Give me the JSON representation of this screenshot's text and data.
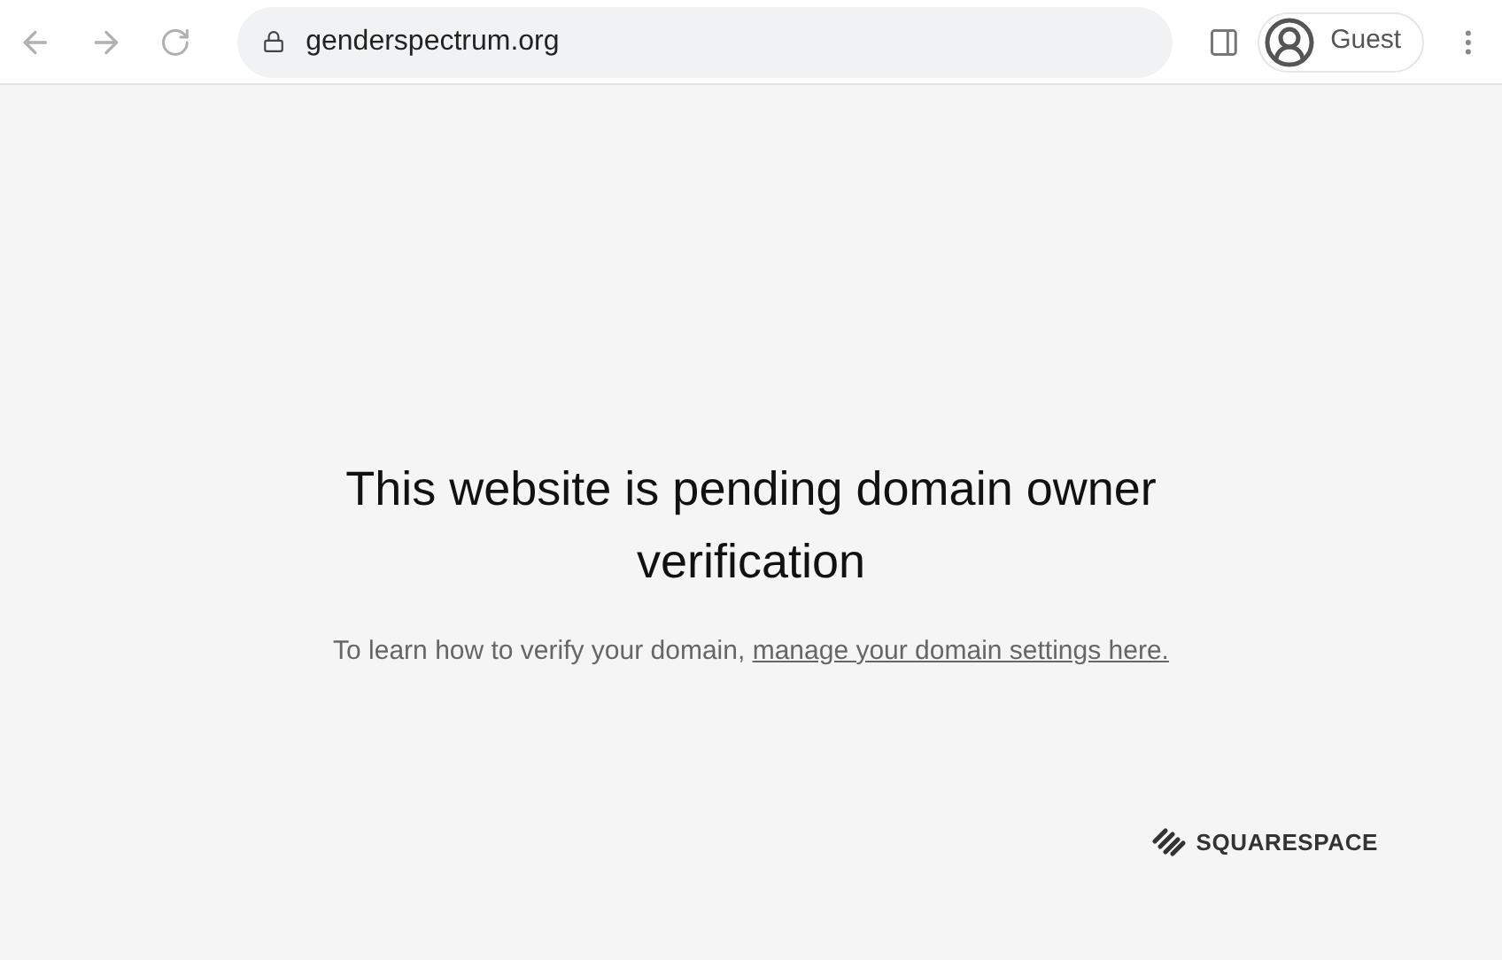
{
  "browser": {
    "url": "genderspectrum.org",
    "profile": "Guest"
  },
  "page": {
    "heading": "This website is pending domain owner verification",
    "text": "To learn how to verify your domain,",
    "link": "manage your domain settings here.",
    "brand": "SQUARESPACE"
  }
}
